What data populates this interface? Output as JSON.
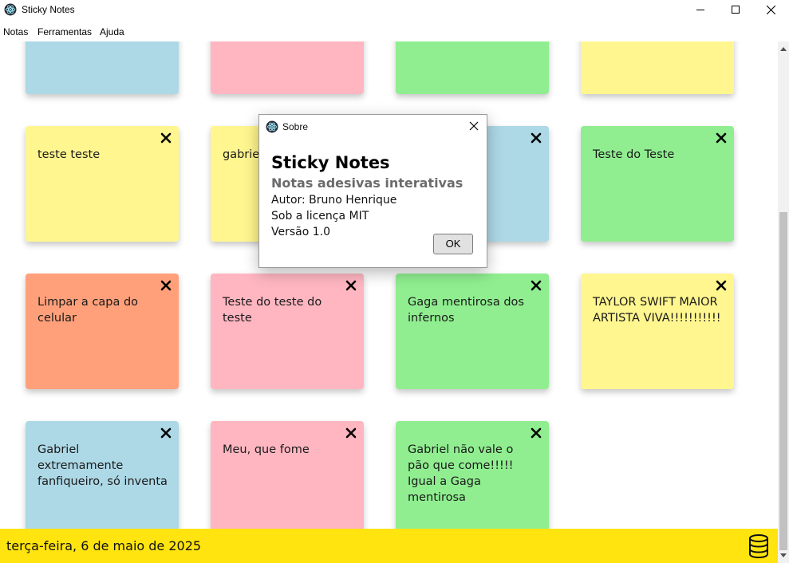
{
  "window": {
    "title": "Sticky Notes",
    "icon": "electron-app-icon"
  },
  "menu": {
    "items": [
      "Notas",
      "Ferramentas",
      "Ajuda"
    ]
  },
  "colors": {
    "blue": "#add8e6",
    "pink": "#ffb6c1",
    "green": "#90ee90",
    "yellow": "#fff68f",
    "orange": "#ffa07a",
    "statusbar": "#ffe40f"
  },
  "notes": [
    {
      "text": "",
      "color": "blue"
    },
    {
      "text": "",
      "color": "pink"
    },
    {
      "text": "",
      "color": "green"
    },
    {
      "text": "",
      "color": "yellow"
    },
    {
      "text": "teste teste",
      "color": "yellow"
    },
    {
      "text": "gabriel",
      "color": "yellow"
    },
    {
      "text": "",
      "color": "blue"
    },
    {
      "text": "Teste do Teste",
      "color": "green"
    },
    {
      "text": "Limpar a capa do celular",
      "color": "orange"
    },
    {
      "text": "Teste do teste do teste",
      "color": "pink"
    },
    {
      "text": "Gaga mentirosa dos infernos",
      "color": "green"
    },
    {
      "text": "TAYLOR SWIFT MAIOR ARTISTA VIVA!!!!!!!!!!!",
      "color": "yellow"
    },
    {
      "text": "Gabriel extremamente fanfiqueiro, só inventa",
      "color": "blue"
    },
    {
      "text": "Meu, que fome",
      "color": "pink"
    },
    {
      "text": "Gabriel não vale o pão que come!!!!! Igual a Gaga mentirosa",
      "color": "green"
    }
  ],
  "status": {
    "date": "terça-feira, 6 de maio de 2025",
    "icon": "database-icon"
  },
  "dialog": {
    "title": "Sobre",
    "heading": "Sticky Notes",
    "subtitle": "Notas adesivas interativas",
    "author": "Autor: Bruno Henrique",
    "license": "Sob a licença MIT",
    "version": "Versão 1.0",
    "ok_label": "OK"
  }
}
